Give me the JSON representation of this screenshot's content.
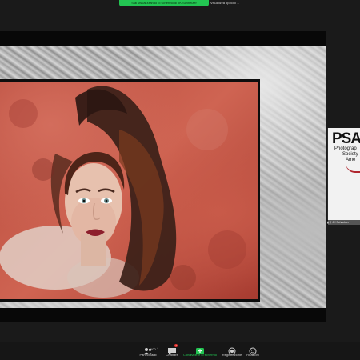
{
  "top_bar": {
    "share_banner": "Stai visualizzando lo schermo di JK Schnelzer",
    "view_options": "Visualizza opzioni ⌄"
  },
  "participant": {
    "logo_text": "PSA",
    "logo_lines": [
      "Photograp",
      "Society",
      "Ame"
    ],
    "name": "JK Schnelzer"
  },
  "toolbar": {
    "participants_label": "Partecipanti",
    "participants_count": "100",
    "chat_label": "Chattare",
    "chat_badge": "1",
    "share_label": "Condividere lo schermo",
    "record_label": "Registrazione",
    "reactions_label": "Reazioni"
  },
  "colors": {
    "share_green": "#23c552",
    "background": "#1a1a1a",
    "art_red": "#c35747"
  }
}
